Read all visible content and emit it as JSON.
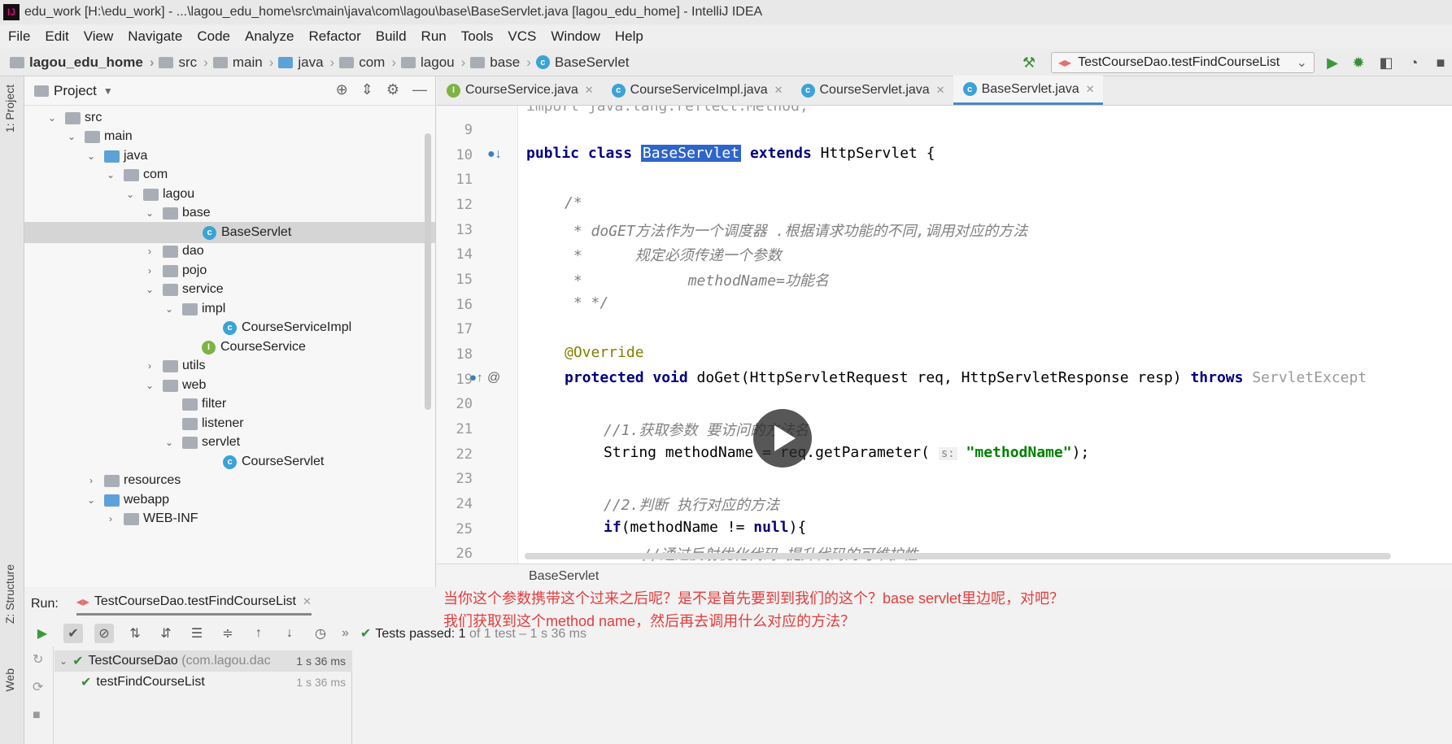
{
  "window": {
    "title": "edu_work [H:\\edu_work] - ...\\lagou_edu_home\\src\\main\\java\\com\\lagou\\base\\BaseServlet.java [lagou_edu_home] - IntelliJ IDEA"
  },
  "menu": [
    "File",
    "Edit",
    "View",
    "Navigate",
    "Code",
    "Analyze",
    "Refactor",
    "Build",
    "Run",
    "Tools",
    "VCS",
    "Window",
    "Help"
  ],
  "breadcrumbs": [
    "lagou_edu_home",
    "src",
    "main",
    "java",
    "com",
    "lagou",
    "base",
    "BaseServlet"
  ],
  "run_config": "TestCourseDao.testFindCourseList",
  "side_tabs": {
    "project": "1: Project",
    "structure": "Z: Structure",
    "web": "Web"
  },
  "project_panel": {
    "title": "Project",
    "tree": [
      {
        "label": "src"
      },
      {
        "label": "main"
      },
      {
        "label": "java"
      },
      {
        "label": "com"
      },
      {
        "label": "lagou"
      },
      {
        "label": "base"
      },
      {
        "label": "BaseServlet"
      },
      {
        "label": "dao"
      },
      {
        "label": "pojo"
      },
      {
        "label": "service"
      },
      {
        "label": "impl"
      },
      {
        "label": "CourseServiceImpl"
      },
      {
        "label": "CourseService"
      },
      {
        "label": "utils"
      },
      {
        "label": "web"
      },
      {
        "label": "filter"
      },
      {
        "label": "listener"
      },
      {
        "label": "servlet"
      },
      {
        "label": "CourseServlet"
      },
      {
        "label": "resources"
      },
      {
        "label": "webapp"
      },
      {
        "label": "WEB-INF"
      }
    ]
  },
  "editor_tabs": [
    "CourseService.java",
    "CourseServiceImpl.java",
    "CourseServlet.java",
    "BaseServlet.java"
  ],
  "code": {
    "line_numbers": [
      "9",
      "10",
      "11",
      "12",
      "13",
      "14",
      "15",
      "16",
      "17",
      "18",
      "19",
      "20",
      "21",
      "22",
      "23",
      "24",
      "25",
      "26"
    ],
    "top_partial": "import java.lang.reflect.Method;",
    "l10_kw": "public class",
    "l10_name": "BaseServlet",
    "l10_kw2": "extends",
    "l10_rest": "HttpServlet {",
    "l12": "/*",
    "l13": " * doGET方法作为一个调度器 .根据请求功能的不同,调用对应的方法",
    "l14": " *      规定必须传递一个参数",
    "l15": " *            methodName=功能名",
    "l16": " * */",
    "l18": "@Override",
    "l19_kw": "protected void",
    "l19_rest": " doGet(HttpServletRequest req, HttpServletResponse resp) ",
    "l19_kw2": "throws",
    "l19_tail": " ServletExcept",
    "l21": "//1.获取参数 要访问的方法名",
    "l22_a": "String methodName = req.getParameter( ",
    "l22_hint": "s:",
    "l22_str": "\"methodName\"",
    "l22_end": ");",
    "l24": "//2.判断 执行对应的方法",
    "l25_kw": "if",
    "l25_mid": "(methodName != ",
    "l25_kw2": "null",
    "l25_end": "){",
    "l26": "//通过反射优化代码 提升代码的可维护性"
  },
  "editor_breadcrumb": "BaseServlet",
  "run_panel": {
    "label": "Run:",
    "tab": "TestCourseDao.testFindCourseList",
    "status_main": "Tests passed: 1",
    "status_sub": "of 1 test – 1 s 36 ms",
    "tests": [
      {
        "name": "TestCourseDao",
        "pkg": "(com.lagou.dac",
        "time": "1 s 36 ms"
      },
      {
        "name": "testFindCourseList",
        "pkg": "",
        "time": "1 s 36 ms"
      }
    ]
  },
  "subtitles": [
    "当你这个参数携带这个过来之后呢？是不是首先要到到我们的这个？base servlet里边呢，对吧？",
    "我们获取到这个method name，然后再去调用什么对应的方法？"
  ],
  "colors": {
    "accent": "#4a88c7",
    "subtitle": "#e43d3d",
    "pass": "#3a8d3a"
  }
}
